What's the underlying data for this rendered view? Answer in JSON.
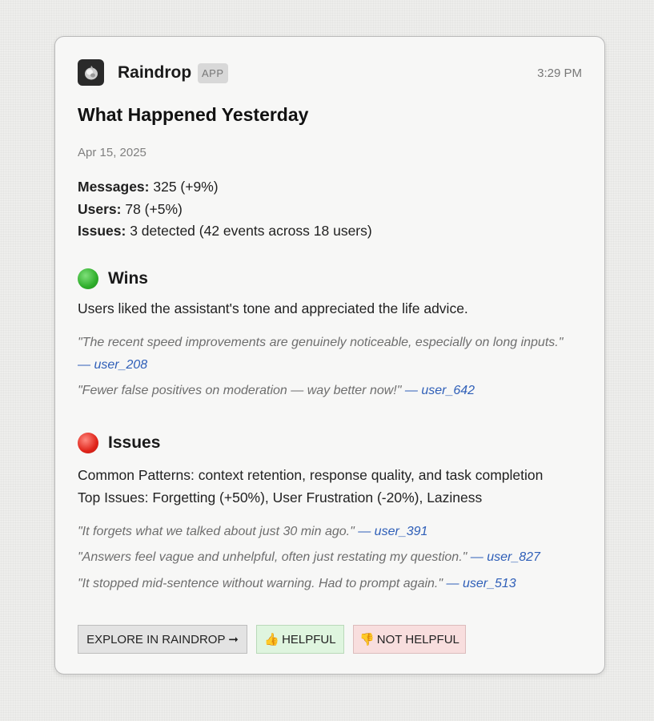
{
  "app": {
    "name": "Raindrop",
    "badge": "APP",
    "time": "3:29 PM"
  },
  "report": {
    "title": "What Happened Yesterday",
    "date": "Apr 15, 2025",
    "stats": [
      {
        "label": "Messages:",
        "value": "325 (+9%)"
      },
      {
        "label": "Users:",
        "value": "78 (+5%)"
      },
      {
        "label": "Issues:",
        "value": "3 detected (42 events across 18 users)"
      }
    ]
  },
  "wins": {
    "heading": "Wins",
    "summary": "Users liked the assistant's tone and appreciated the life advice.",
    "quotes": [
      {
        "text": "\"The recent speed improvements are genuinely noticeable, especially on long inputs.\"",
        "user": "— user_208"
      },
      {
        "text": "\"Fewer false positives on moderation — way better now!\"",
        "user": "— user_642"
      }
    ]
  },
  "issues": {
    "heading": "Issues",
    "patterns": "Common Patterns: context retention, response quality, and task completion",
    "top": "Top Issues: Forgetting (+50%), User Frustration (-20%), Laziness",
    "quotes": [
      {
        "text": "\"It forgets what we talked about just 30 min ago.\"",
        "user": "— user_391"
      },
      {
        "text": "\"Answers feel vague and unhelpful, often just restating my question.\"",
        "user": "— user_827"
      },
      {
        "text": "\"It stopped mid-sentence without warning. Had to prompt again.\"",
        "user": "— user_513"
      }
    ]
  },
  "buttons": {
    "explore": "EXPLORE IN RAINDROP ➞",
    "helpful": "HELPFUL",
    "not_helpful": "NOT HELPFUL"
  },
  "colors": {
    "win_dot": "#2fae2b",
    "issue_dot": "#e0241a",
    "link": "#2f5fb8"
  },
  "icons": {
    "app": "raindrop-logo-icon",
    "wins": "green-circle-icon",
    "issues": "red-circle-icon",
    "helpful": "thumbs-up-icon",
    "not_helpful": "thumbs-down-icon"
  }
}
